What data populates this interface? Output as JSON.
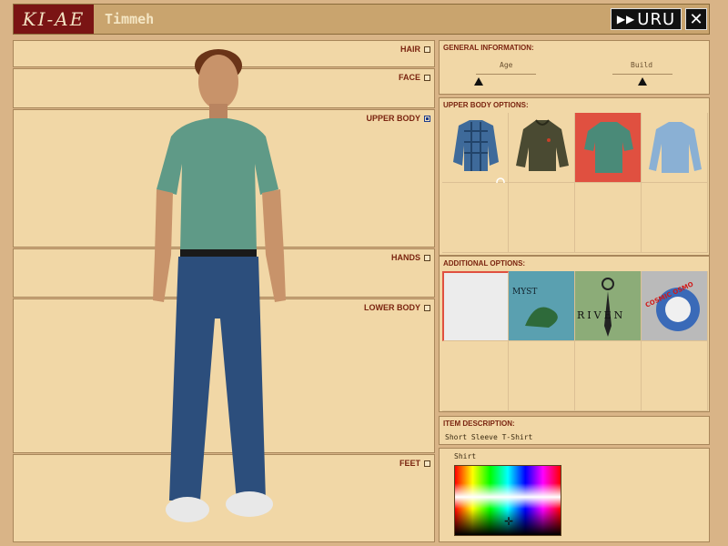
{
  "header": {
    "logo_text": "KI-AE",
    "player_name": "Timmeh",
    "uru_label": "URU",
    "close_label": "✕"
  },
  "body_panels": {
    "hair": "HAIR",
    "face": "FACE",
    "upper_body": "UPPER BODY",
    "hands": "HANDS",
    "lower_body": "LOWER BODY",
    "feet": "FEET",
    "selected": "upper_body"
  },
  "general": {
    "title": "GENERAL INFORMATION:",
    "age_label": "Age",
    "build_label": "Build",
    "age_value": 0.1,
    "build_value": 0.5
  },
  "upper_body_options": {
    "title": "UPPER BODY OPTIONS:",
    "items": [
      "plaid-jacket",
      "hooded-jacket",
      "short-sleeve-shirt",
      "long-sleeve-shirt"
    ],
    "selected_index": 2
  },
  "additional_options": {
    "title": "ADDITIONAL OPTIONS:",
    "items": [
      "plain-texture",
      "myst-logo",
      "riven-logo",
      "cosmic-osmo-logo"
    ],
    "selected_index": 0,
    "myst_text": "MYST",
    "riven_text": "RIVEN",
    "osmo_text": "COSMIC OSMO"
  },
  "item_description": {
    "title": "ITEM DESCRIPTION:",
    "value": "Short Sleeve T-Shirt"
  },
  "color": {
    "label": "Shirt"
  },
  "colors": {
    "frame": "#c9a46e",
    "panel": "#f1d7a6",
    "accent": "#7a2410",
    "selected": "#e05040"
  }
}
